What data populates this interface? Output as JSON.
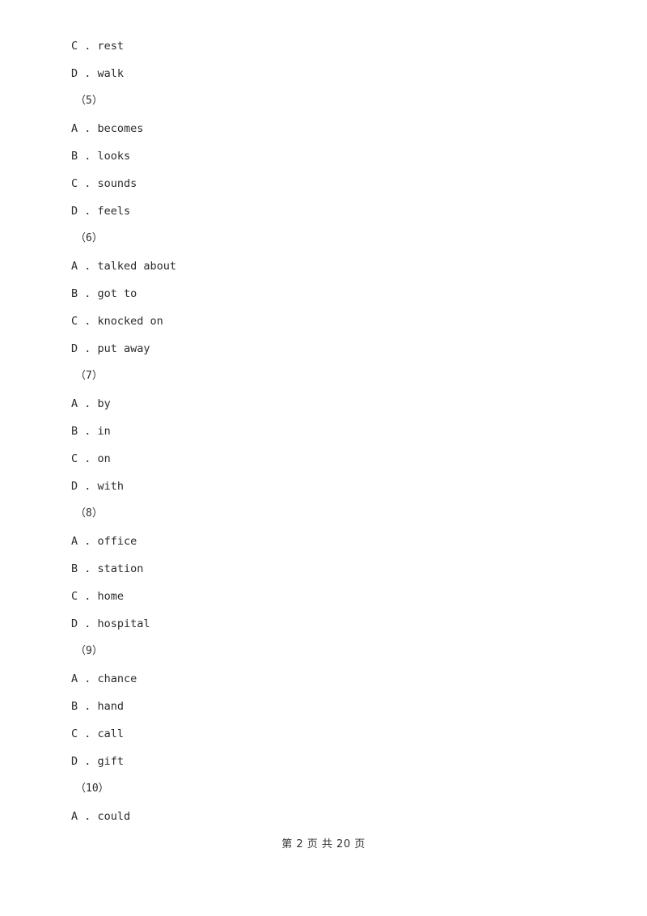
{
  "document": {
    "type": "exam-paper",
    "page_background": "#ffffff",
    "text_color": "#2b2b2b"
  },
  "body_lines": [
    {
      "kind": "option",
      "text": "C . rest"
    },
    {
      "kind": "option",
      "text": "D . walk"
    },
    {
      "kind": "question",
      "text": "（5）"
    },
    {
      "kind": "option",
      "text": "A . becomes"
    },
    {
      "kind": "option",
      "text": "B . looks"
    },
    {
      "kind": "option",
      "text": "C . sounds"
    },
    {
      "kind": "option",
      "text": "D . feels"
    },
    {
      "kind": "question",
      "text": "（6）"
    },
    {
      "kind": "option",
      "text": "A . talked about"
    },
    {
      "kind": "option",
      "text": "B . got to"
    },
    {
      "kind": "option",
      "text": "C . knocked on"
    },
    {
      "kind": "option",
      "text": "D . put away"
    },
    {
      "kind": "question",
      "text": "（7）"
    },
    {
      "kind": "option",
      "text": "A . by"
    },
    {
      "kind": "option",
      "text": "B . in"
    },
    {
      "kind": "option",
      "text": "C . on"
    },
    {
      "kind": "option",
      "text": "D . with"
    },
    {
      "kind": "question",
      "text": "（8）"
    },
    {
      "kind": "option",
      "text": "A . office"
    },
    {
      "kind": "option",
      "text": "B . station"
    },
    {
      "kind": "option",
      "text": "C . home"
    },
    {
      "kind": "option",
      "text": "D . hospital"
    },
    {
      "kind": "question",
      "text": "（9）"
    },
    {
      "kind": "option",
      "text": "A . chance"
    },
    {
      "kind": "option",
      "text": "B . hand"
    },
    {
      "kind": "option",
      "text": "C . call"
    },
    {
      "kind": "option",
      "text": "D . gift"
    },
    {
      "kind": "question",
      "text": "（10）"
    },
    {
      "kind": "option",
      "text": "A . could"
    }
  ],
  "footer": {
    "text": "第 2 页 共 20 页",
    "current_page": "2",
    "total_pages": "20"
  }
}
